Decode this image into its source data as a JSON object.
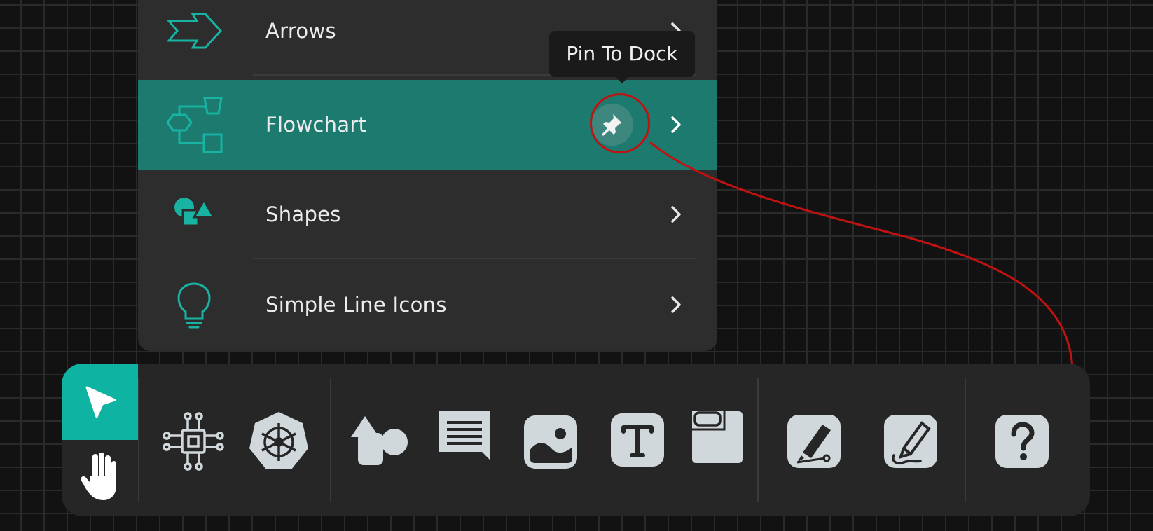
{
  "menu": {
    "items": [
      {
        "label": "Arrows",
        "icon": "arrow-icon"
      },
      {
        "label": "Flowchart",
        "icon": "flowchart-icon",
        "active": true
      },
      {
        "label": "Shapes",
        "icon": "shapes-icon"
      },
      {
        "label": "Simple Line Icons",
        "icon": "lightbulb-icon"
      }
    ],
    "pin_tooltip": "Pin To Dock"
  },
  "dock": {
    "tools": [
      {
        "name": "select-tool",
        "icon": "cursor-icon",
        "active": true
      },
      {
        "name": "pan-tool",
        "icon": "hand-icon"
      },
      {
        "name": "architecture-tool",
        "icon": "chip-icon"
      },
      {
        "name": "kubernetes-tool",
        "icon": "helm-wheel-icon"
      },
      {
        "name": "shapes-tool",
        "icon": "shapes-icon"
      },
      {
        "name": "comment-tool",
        "icon": "speech-bubble-icon"
      },
      {
        "name": "image-tool",
        "icon": "image-icon"
      },
      {
        "name": "text-tool",
        "icon": "text-icon"
      },
      {
        "name": "frame-tool",
        "icon": "frame-icon"
      },
      {
        "name": "pen-tool",
        "icon": "pen-icon"
      },
      {
        "name": "pencil-tool",
        "icon": "pencil-icon"
      },
      {
        "name": "help-tool",
        "icon": "question-icon"
      }
    ]
  },
  "colors": {
    "accent": "#0fb3a1",
    "menu_active": "#1c7a6f",
    "annotation": "#c11212",
    "dock_bg": "#262626",
    "menu_bg": "#2d2d2d"
  }
}
